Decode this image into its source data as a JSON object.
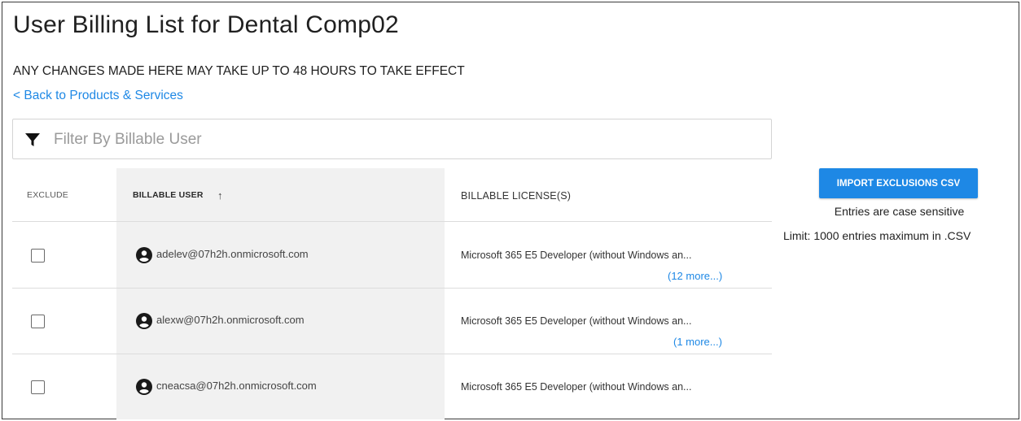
{
  "page": {
    "title": "User Billing List for Dental Comp02",
    "notice": "ANY CHANGES MADE HERE MAY TAKE UP TO 48 HOURS TO TAKE EFFECT",
    "back_link": "< Back to Products & Services"
  },
  "filter": {
    "icon": "filter-icon",
    "placeholder": "Filter By Billable User",
    "value": ""
  },
  "table": {
    "columns": {
      "exclude": "EXCLUDE",
      "billable_user": "BILLABLE USER",
      "billable_user_sort": "↑",
      "billable_license": "BILLABLE LICENSE(S)"
    },
    "rows": [
      {
        "excluded": false,
        "user": "adelev@07h2h.onmicrosoft.com",
        "license": "Microsoft 365 E5 Developer (without Windows an...",
        "more": "(12 more...)"
      },
      {
        "excluded": false,
        "user": "alexw@07h2h.onmicrosoft.com",
        "license": "Microsoft 365 E5 Developer (without Windows an...",
        "more": "(1 more...)"
      },
      {
        "excluded": false,
        "user": "cneacsa@07h2h.onmicrosoft.com",
        "license": "Microsoft 365 E5 Developer (without Windows an...",
        "more": ""
      }
    ]
  },
  "sidebar": {
    "import_button": "IMPORT EXCLUSIONS CSV",
    "case_note": "Entries are case sensitive",
    "limit_note": "Limit: 1000 entries maximum in .CSV"
  },
  "colors": {
    "accent": "#1e88e5",
    "header_bg": "#f1f1f1"
  }
}
